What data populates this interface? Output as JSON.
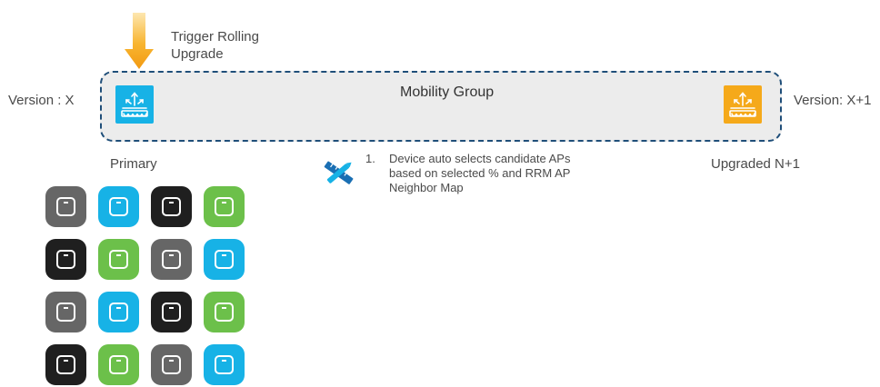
{
  "trigger": {
    "line1": "Trigger Rolling",
    "line2": "Upgrade"
  },
  "mobility_group": {
    "title": "Mobility Group"
  },
  "primary_controller": {
    "version_label": "Version : X",
    "role_label": "Primary",
    "color": "#17b2e6",
    "icon": "wireless-controller-icon"
  },
  "upgraded_controller": {
    "version_label": "Version: X+1",
    "role_label": "Upgraded N+1",
    "color": "#f5a91a",
    "icon": "wireless-controller-icon"
  },
  "step": {
    "number": "1.",
    "lines": [
      "Device auto selects candidate APs",
      "based on selected % and RRM AP",
      "Neighbor Map"
    ],
    "icon": "tools-icon"
  },
  "access_points": {
    "icon": "access-point-icon",
    "colors": {
      "gray": "#666666",
      "blue": "#17b2e6",
      "black": "#1f1f1f",
      "green": "#6cc04a"
    },
    "grid": [
      [
        "gray",
        "blue",
        "black",
        "green"
      ],
      [
        "black",
        "green",
        "gray",
        "blue"
      ],
      [
        "gray",
        "blue",
        "black",
        "green"
      ],
      [
        "black",
        "green",
        "gray",
        "blue"
      ]
    ]
  },
  "arrow_color": "#f5a91a"
}
